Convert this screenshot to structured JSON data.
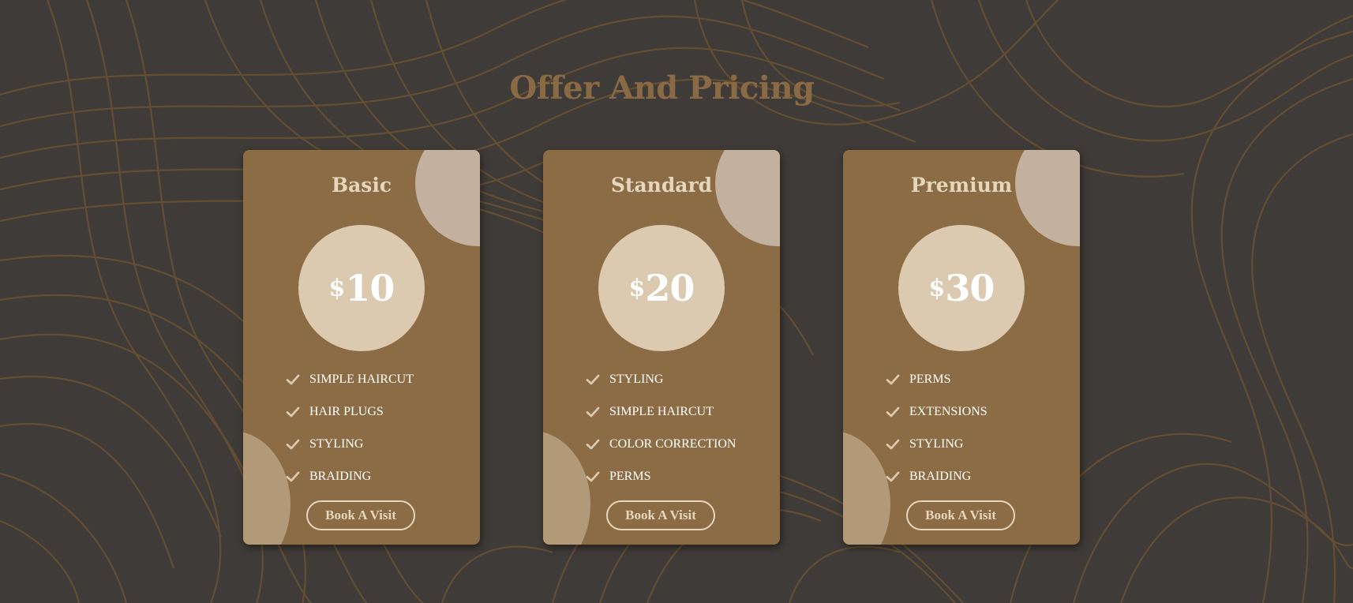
{
  "page": {
    "title": "Offer And Pricing",
    "colors": {
      "background": "#3f3b38",
      "pattern_line": "#6b5232",
      "card": "#8b6c45",
      "circle": "#dbcab0",
      "accent": "#e6d6bd"
    }
  },
  "plans": [
    {
      "name": "Basic",
      "currency": "$",
      "price": "10",
      "features": [
        "SIMPLE HAIRCUT",
        "HAIR PLUGS",
        "STYLING",
        "BRAIDING"
      ],
      "check_icon": "check-icon",
      "button_label": "Book A Visit"
    },
    {
      "name": "Standard",
      "currency": "$",
      "price": "20",
      "features": [
        "STYLING",
        "SIMPLE HAIRCUT",
        "COLOR CORRECTION",
        "PERMS"
      ],
      "check_icon": "check-icon",
      "button_label": "Book A Visit"
    },
    {
      "name": "Premium",
      "currency": "$",
      "price": "30",
      "features": [
        "PERMS",
        "EXTENSIONS",
        "STYLING",
        "BRAIDING"
      ],
      "check_icon": "check-icon",
      "button_label": "Book A Visit"
    }
  ]
}
